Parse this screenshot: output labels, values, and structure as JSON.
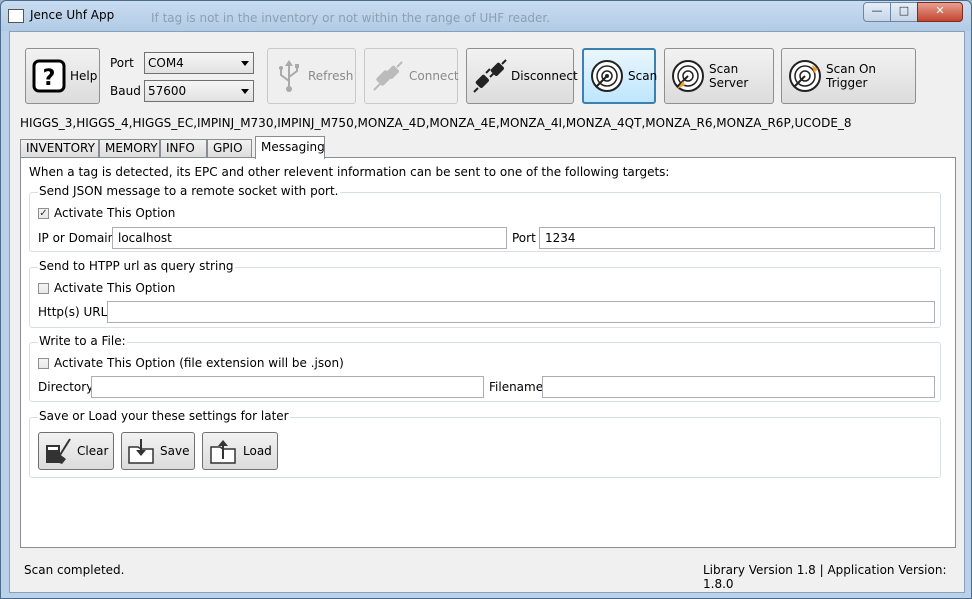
{
  "window": {
    "title": "Jence Uhf App",
    "ghost_text": "If tag is not in the inventory or not within the range of UHF reader.",
    "minimize": "—",
    "maximize": "□",
    "close": "✕"
  },
  "toolbar": {
    "help": "Help",
    "port_label": "Port",
    "port_value": "COM4",
    "baud_label": "Baud",
    "baud_value": "57600",
    "refresh": "Refresh",
    "connect": "Connect",
    "disconnect": "Disconnect",
    "scan": "Scan",
    "scan_server": "Scan Server",
    "scan_on_trigger": "Scan On Trigger"
  },
  "tag_types": "HIGGS_3,HIGGS_4,HIGGS_EC,IMPINJ_M730,IMPINJ_M750,MONZA_4D,MONZA_4E,MONZA_4I,MONZA_4QT,MONZA_R6,MONZA_R6P,UCODE_8",
  "tabs": [
    "INVENTORY",
    "MEMORY",
    "INFO",
    "GPIO",
    "Messaging"
  ],
  "selected_tab": "Messaging",
  "messaging": {
    "intro": "When a tag is detected, its EPC and other relevent information can be sent to one of the following targets:",
    "json": {
      "title": "Send JSON message to a remote socket with port.",
      "activate_label": "Activate This Option",
      "activated": true,
      "ip_label": "IP or Domain",
      "ip_value": "localhost",
      "port_label": "Port",
      "port_value": "1234"
    },
    "http": {
      "title": "Send to HTPP url as query string",
      "activate_label": "Activate This Option",
      "activated": false,
      "url_label": "Http(s) URL:",
      "url_value": ""
    },
    "file": {
      "title": "Write to a File:",
      "activate_label": "Activate This Option (file extension will be .json)",
      "activated": false,
      "dir_label": "Directory",
      "dir_value": "",
      "filename_label": "Filename",
      "filename_value": ""
    },
    "settings": {
      "title": "Save or Load your these settings for later",
      "clear": "Clear",
      "save": "Save",
      "load": "Load"
    }
  },
  "status": {
    "message": "Scan completed.",
    "version": "Library Version 1.8 | Application Version: 1.8.0"
  },
  "icons": {
    "help": "question-icon",
    "refresh": "usb-icon",
    "connect": "plug-icon",
    "disconnect": "unplug-icon",
    "scan": "radar-icon",
    "scan_server": "radar-server-icon",
    "scan_on_trigger": "radar-trigger-icon",
    "clear": "broom-icon",
    "save": "folder-save-icon",
    "load": "folder-load-icon"
  },
  "colors": {
    "active_border": "#3c7fb1",
    "tab_border": "#898c95"
  }
}
